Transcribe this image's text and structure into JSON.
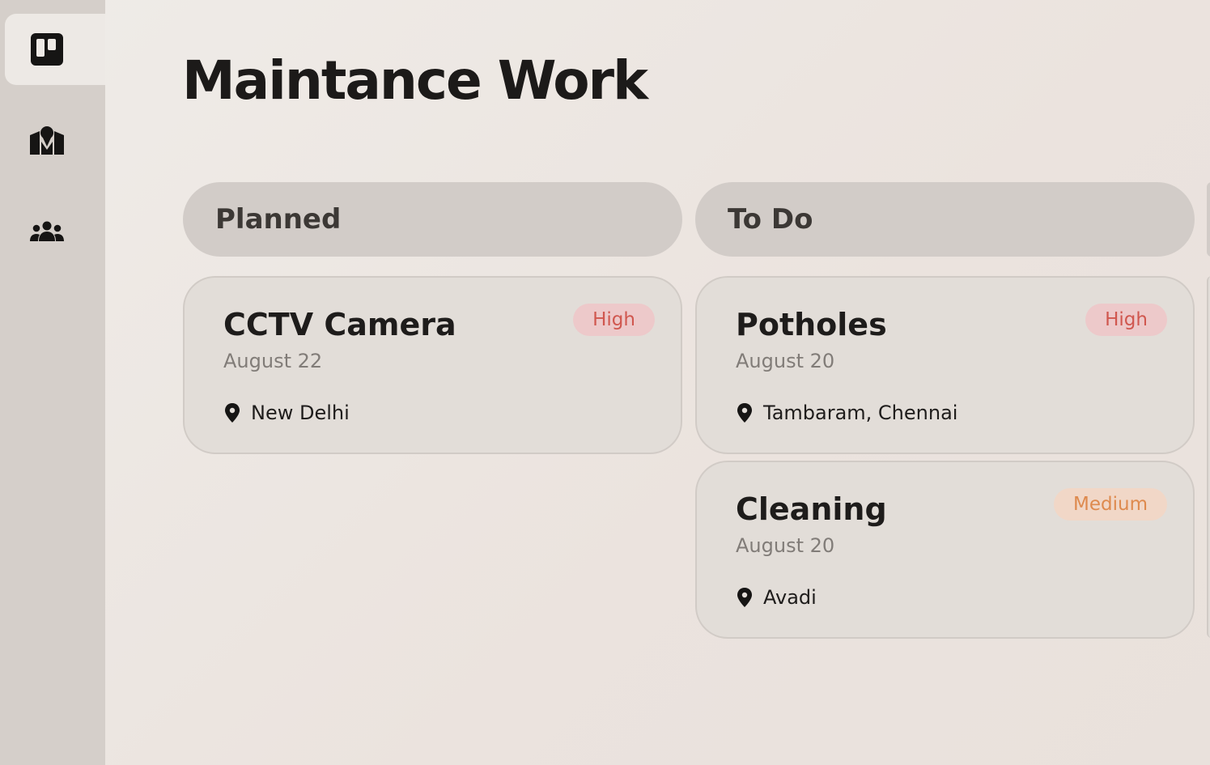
{
  "app": {
    "title": "Maintance Work"
  },
  "sidebar": {
    "items": [
      {
        "icon": "board-icon",
        "active": true
      },
      {
        "icon": "map-pin-icon",
        "active": false
      },
      {
        "icon": "users-icon",
        "active": false
      }
    ]
  },
  "columns": [
    {
      "title": "Planned",
      "cards": [
        {
          "title": "CCTV Camera",
          "date": "August 22",
          "location": "New Delhi",
          "priority": "High"
        }
      ]
    },
    {
      "title": "To Do",
      "cards": [
        {
          "title": "Potholes",
          "date": "August 20",
          "location": "Tambaram, Chennai",
          "priority": "High"
        },
        {
          "title": "Cleaning",
          "date": "August 20",
          "location": "Avadi",
          "priority": "Medium"
        }
      ]
    }
  ],
  "colors": {
    "sidebar_bg": "#d5cfca",
    "column_header_bg": "#d2ccc8",
    "card_bg": "#e2ddd8",
    "priority_high_bg": "#edc9ca",
    "priority_high_text": "#d0574f",
    "priority_medium_bg": "#f1d7c7",
    "priority_medium_text": "#de8a4e"
  }
}
